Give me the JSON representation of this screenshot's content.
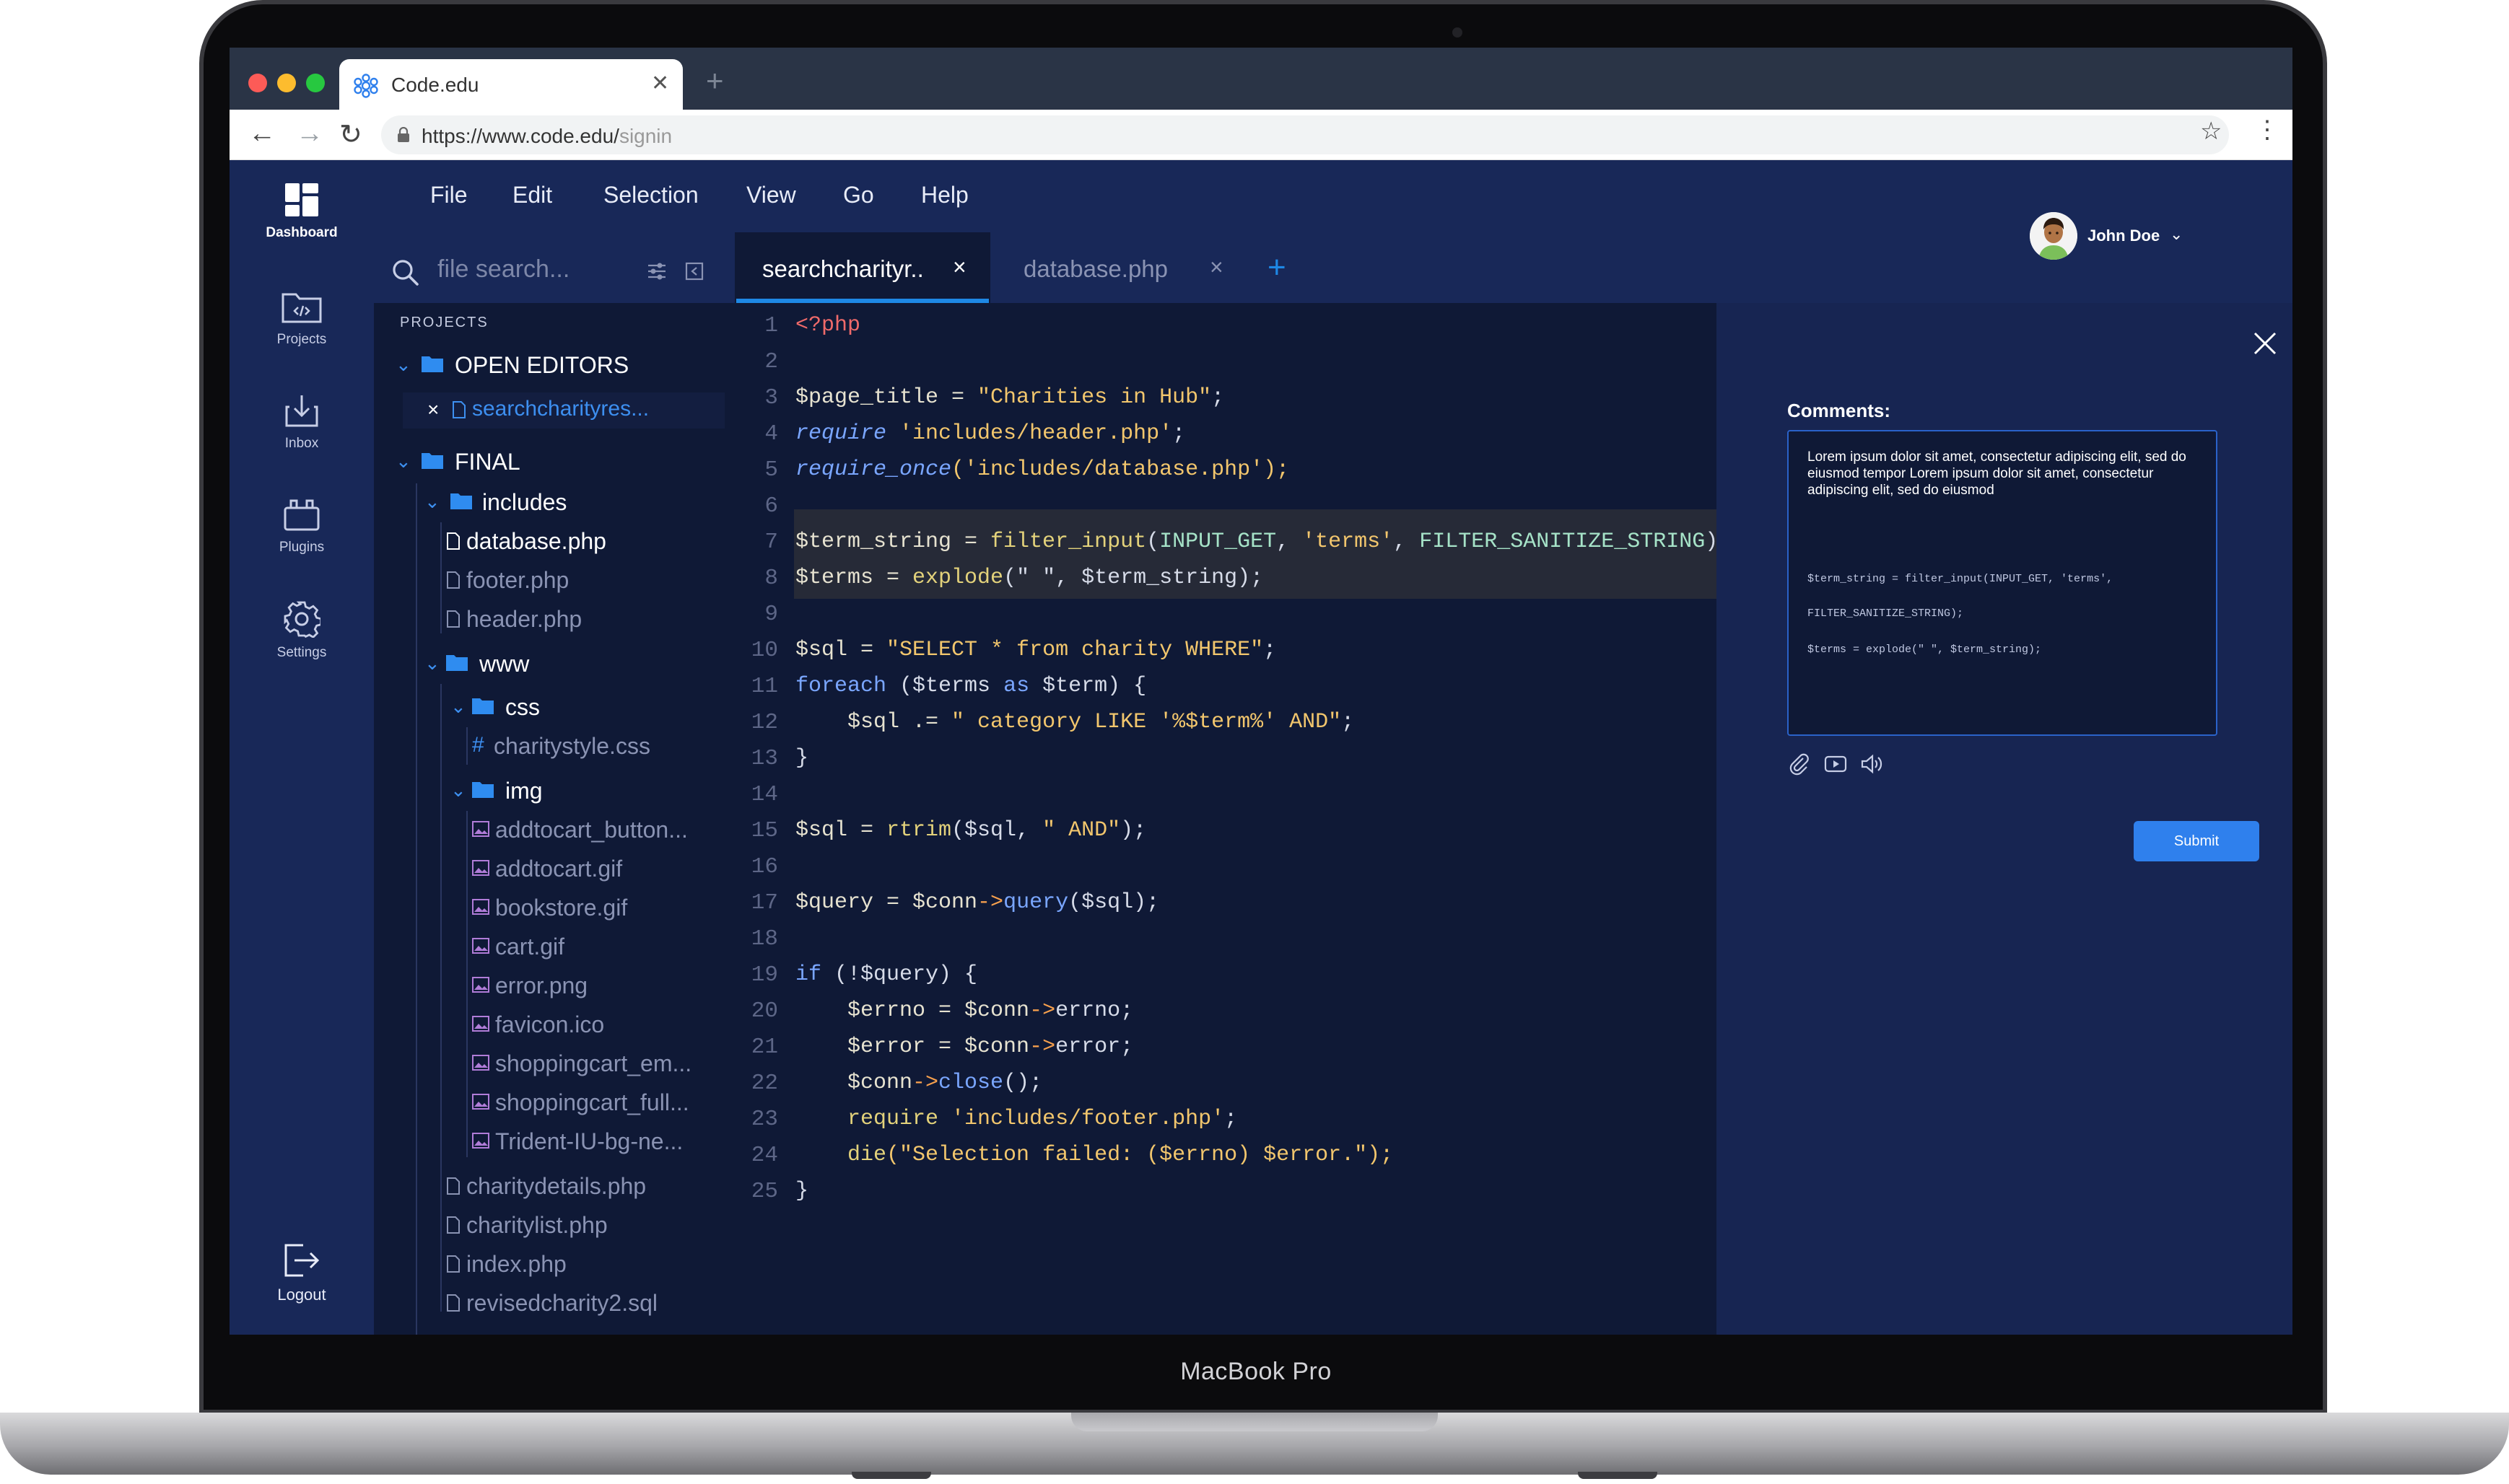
{
  "device": {
    "label": "MacBook Pro"
  },
  "browser": {
    "tab_title": "Code.edu",
    "new_tab": "+",
    "url_host": "https://www.code.edu/",
    "url_path": "signin"
  },
  "app": {
    "nav": [
      {
        "label": "Dashboard",
        "icon": "dashboard-icon"
      },
      {
        "label": "Projects",
        "icon": "projects-icon"
      },
      {
        "label": "Inbox",
        "icon": "inbox-icon"
      },
      {
        "label": "Plugins",
        "icon": "plugins-icon"
      },
      {
        "label": "Settings",
        "icon": "gear-icon"
      },
      {
        "label": "Logout",
        "icon": "logout-icon"
      }
    ],
    "menu": [
      "File",
      "Edit",
      "Selection",
      "View",
      "Go",
      "Help"
    ],
    "user": {
      "name": "John Doe"
    },
    "search": {
      "placeholder": "file search..."
    },
    "tabs": [
      {
        "label": "searchcharityr..",
        "close": "×"
      },
      {
        "label": "database.php",
        "close": "×"
      }
    ],
    "add_tab": "+"
  },
  "explorer": {
    "heading": "PROJECTS",
    "open_editors": "OPEN EDITORS",
    "open_file": "searchcharityres...",
    "open_file_close": "×",
    "root": "FINAL",
    "folders": {
      "includes": "includes",
      "www": "www",
      "css": "css",
      "img": "img"
    },
    "include_files": [
      "database.php",
      "footer.php",
      "header.php"
    ],
    "css_files": [
      "charitystyle.css"
    ],
    "img_files": [
      "addtocart_button...",
      "addtocart.gif",
      "bookstore.gif",
      "cart.gif",
      "error.png",
      "favicon.ico",
      "shoppingcart_em...",
      "shoppingcart_full...",
      "Trident-IU-bg-ne..."
    ],
    "www_files": [
      "charitydetails.php",
      "charitylist.php",
      "index.php",
      "revisedcharity2.sql"
    ]
  },
  "code": {
    "line_numbers": [
      "1",
      "2",
      "3",
      "4",
      "5",
      "6",
      "7",
      "8",
      "9",
      "10",
      "11",
      "12",
      "13",
      "14",
      "15",
      "16",
      "17",
      "18",
      "19",
      "20",
      "21",
      "22",
      "23",
      "24",
      "25"
    ],
    "lines": {
      "l1": {
        "a": "<?php"
      },
      "l3": {
        "a": "$page_title = ",
        "b": "\"Charities in Hub\"",
        "c": ";"
      },
      "l4": {
        "a": "require",
        "b": " 'includes/header.php'",
        "c": ";"
      },
      "l5": {
        "a": "require_once",
        "b": "('includes/database.php');"
      },
      "l7": {
        "a": "$term_string = ",
        "b": "filter_input",
        "c": "(",
        "d": "INPUT_GET",
        "e": ", ",
        "f": "'terms'",
        "g": ", ",
        "h": "FILTER_SANITIZE_STRING",
        "i": ");"
      },
      "l8": {
        "a": "$terms = ",
        "b": "explode",
        "c": "(\" \", $term_string);"
      },
      "l10": {
        "a": "$sql = ",
        "b": "\"SELECT * from charity WHERE\"",
        "c": ";"
      },
      "l11": {
        "a": "foreach",
        "b": " ($terms ",
        "c": "as",
        "d": " $term) {"
      },
      "l12": {
        "a": "    $sql .= ",
        "b": "\" category LIKE '%$term%' AND\"",
        "c": ";"
      },
      "l13": {
        "a": "}"
      },
      "l15": {
        "a": "$sql = ",
        "b": "rtrim",
        "c": "($sql, ",
        "d": "\" AND\"",
        "e": ");"
      },
      "l17": {
        "a": "$query = $conn",
        "b": "->",
        "c": "query",
        "d": "($sql);"
      },
      "l19": {
        "a": "if",
        "b": " (!$query) {"
      },
      "l20": {
        "a": "    $errno = $conn",
        "b": "->",
        "c": "errno;"
      },
      "l21": {
        "a": "    $error = $conn",
        "b": "->",
        "c": "error;"
      },
      "l22": {
        "a": "    $conn",
        "b": "->",
        "c": "close",
        "d": "();"
      },
      "l23": {
        "a": "    require",
        "b": " 'includes/footer.php'",
        "c": ";"
      },
      "l24": {
        "a": "    die",
        "b": "(\"Selection failed: ($errno) $error.\");"
      },
      "l25": {
        "a": "}"
      }
    }
  },
  "comments": {
    "label": "Comments:",
    "text": "Lorem ipsum dolor sit amet, consectetur adipiscing elit, sed do eiusmod tempor Lorem ipsum dolor sit amet, consectetur adipiscing elit, sed do eiusmod",
    "code1": "$term_string = filter_input(INPUT_GET, 'terms',",
    "code2": "FILTER_SANITIZE_STRING);",
    "code3": "$terms = explode(\" \", $term_string);",
    "submit": "Submit"
  },
  "colors": {
    "screen_bg": "#0f1936",
    "sidebar_bg": "#182858",
    "panel_bg": "#172552",
    "accent": "#1e88e5",
    "submit": "#2f80ed"
  }
}
